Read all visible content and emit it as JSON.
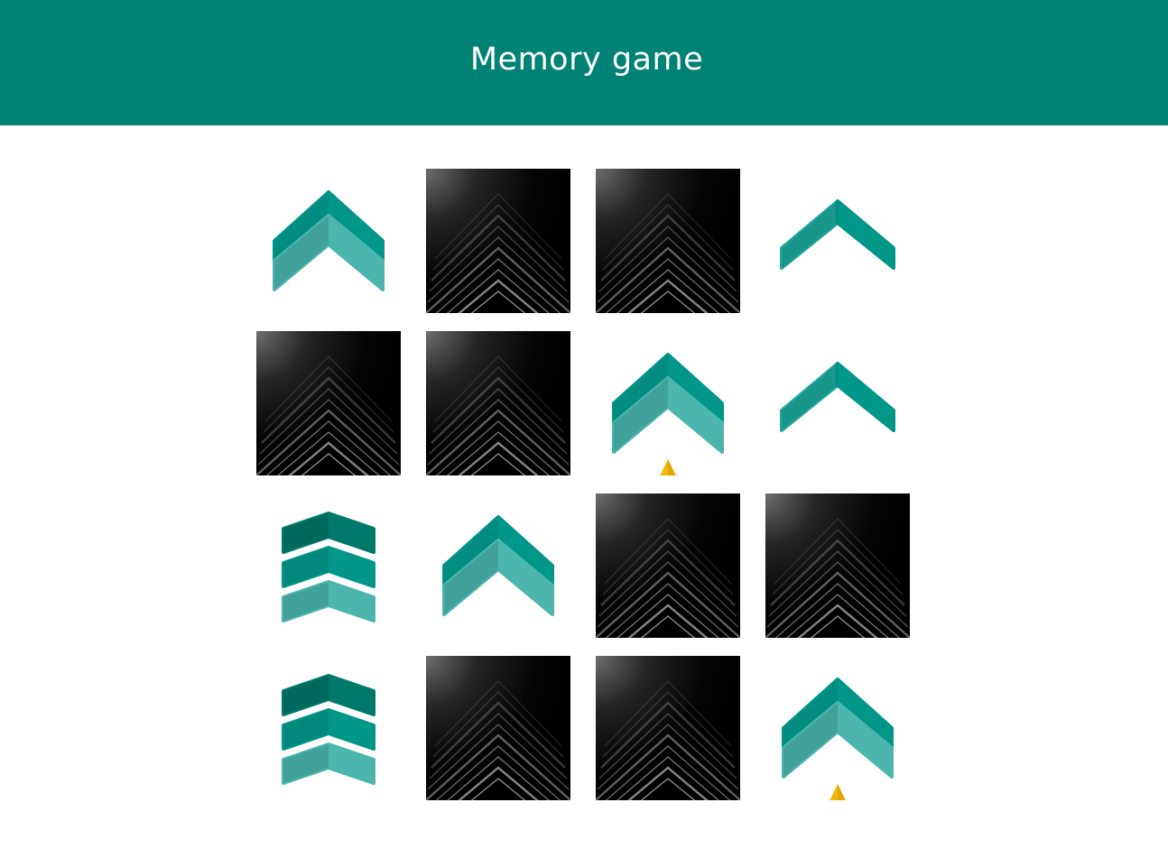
{
  "header": {
    "title": "Memory game"
  },
  "colors": {
    "header_bg": "#008275",
    "teal_dark": "#00796b",
    "teal": "#009688",
    "teal_mid": "#26a69a",
    "teal_light": "#4db6ac",
    "teal_muted": "#40a198",
    "star": "#f2b705",
    "star_shade": "#e0a400",
    "card_back": "#000000"
  },
  "board": {
    "columns": 4,
    "rows": 4,
    "cards": [
      {
        "state": "face-up",
        "icon": "double-chevron-up-icon"
      },
      {
        "state": "face-down",
        "icon": "card-back-pattern"
      },
      {
        "state": "face-down",
        "icon": "card-back-pattern"
      },
      {
        "state": "face-up",
        "icon": "chevron-up-icon"
      },
      {
        "state": "face-down",
        "icon": "card-back-pattern"
      },
      {
        "state": "face-down",
        "icon": "card-back-pattern"
      },
      {
        "state": "face-up",
        "icon": "double-chevron-star-icon"
      },
      {
        "state": "face-up",
        "icon": "chevron-up-icon"
      },
      {
        "state": "face-up",
        "icon": "triple-chevron-icon"
      },
      {
        "state": "face-up",
        "icon": "double-chevron-up-icon"
      },
      {
        "state": "face-down",
        "icon": "card-back-pattern"
      },
      {
        "state": "face-down",
        "icon": "card-back-pattern"
      },
      {
        "state": "face-up",
        "icon": "triple-chevron-icon"
      },
      {
        "state": "face-down",
        "icon": "card-back-pattern"
      },
      {
        "state": "face-down",
        "icon": "card-back-pattern"
      },
      {
        "state": "face-up",
        "icon": "double-chevron-star-icon"
      }
    ]
  }
}
